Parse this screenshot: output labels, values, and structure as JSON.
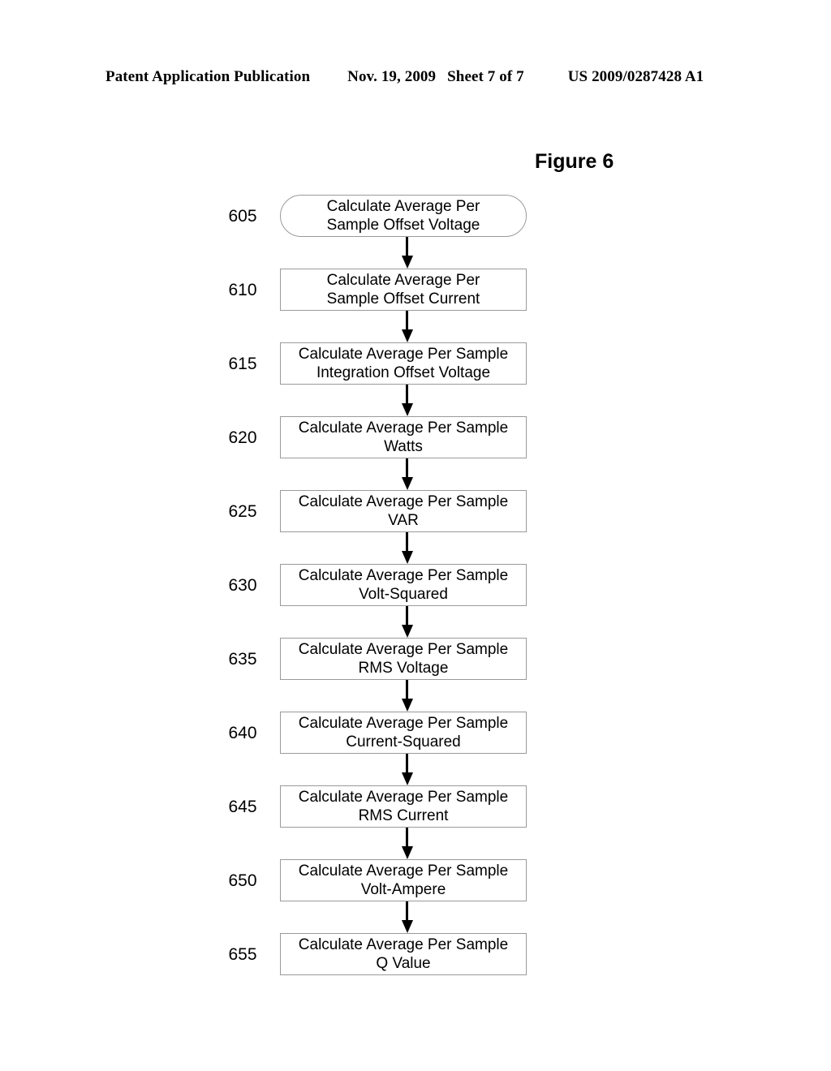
{
  "header": {
    "publication": "Patent Application Publication",
    "date": "Nov. 19, 2009",
    "sheet": "Sheet 7 of 7",
    "patent_number": "US 2009/0287428 A1"
  },
  "figure": {
    "title": "Figure 6"
  },
  "flowchart": {
    "steps": [
      {
        "ref": "605",
        "shape": "terminal",
        "line1": "Calculate Average Per",
        "line2": "Sample Offset Voltage"
      },
      {
        "ref": "610",
        "shape": "process",
        "line1": "Calculate Average Per",
        "line2": "Sample Offset Current"
      },
      {
        "ref": "615",
        "shape": "process",
        "line1": "Calculate Average Per Sample",
        "line2": "Integration Offset Voltage"
      },
      {
        "ref": "620",
        "shape": "process",
        "line1": "Calculate Average Per Sample",
        "line2": "Watts"
      },
      {
        "ref": "625",
        "shape": "process",
        "line1": "Calculate Average Per Sample",
        "line2": "VAR"
      },
      {
        "ref": "630",
        "shape": "process",
        "line1": "Calculate Average Per Sample",
        "line2": "Volt-Squared"
      },
      {
        "ref": "635",
        "shape": "process",
        "line1": "Calculate Average Per Sample",
        "line2": "RMS Voltage"
      },
      {
        "ref": "640",
        "shape": "process",
        "line1": "Calculate Average Per Sample",
        "line2": "Current-Squared"
      },
      {
        "ref": "645",
        "shape": "process",
        "line1": "Calculate Average Per Sample",
        "line2": "RMS Current"
      },
      {
        "ref": "650",
        "shape": "process",
        "line1": "Calculate Average Per Sample",
        "line2": "Volt-Ampere"
      },
      {
        "ref": "655",
        "shape": "process",
        "line1": "Calculate Average Per Sample",
        "line2": "Q Value"
      }
    ]
  },
  "colors": {
    "ink": "#000000",
    "box_border": "#9a9a9a",
    "paper": "#ffffff"
  }
}
